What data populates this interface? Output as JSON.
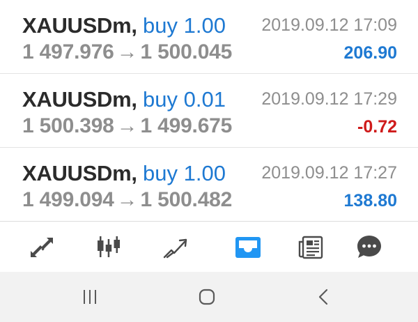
{
  "trades": [
    {
      "symbol": "XAUUSDm",
      "action": "buy 1.00",
      "time": "2019.09.12 17:09",
      "open_price": "1 497.976",
      "close_price": "1 500.045",
      "profit": "206.90",
      "profit_color": "#1e79d2"
    },
    {
      "symbol": "XAUUSDm",
      "action": "buy 0.01",
      "time": "2019.09.12 17:29",
      "open_price": "1 500.398",
      "close_price": "1 499.675",
      "profit": "-0.72",
      "profit_color": "#cf1b1b"
    },
    {
      "symbol": "XAUUSDm",
      "action": "buy 1.00",
      "time": "2019.09.12 17:27",
      "open_price": "1 499.094",
      "close_price": "1 500.482",
      "profit": "138.80",
      "profit_color": "#1e79d2"
    }
  ],
  "arrow": "→",
  "tabbar": {
    "tabs": [
      {
        "icon": "quotes-arrows-icon",
        "active": false
      },
      {
        "icon": "candlestick-chart-icon",
        "active": false
      },
      {
        "icon": "trade-trend-icon",
        "active": false
      },
      {
        "icon": "history-inbox-icon",
        "active": true
      },
      {
        "icon": "news-icon",
        "active": false
      },
      {
        "icon": "chat-icon",
        "active": false
      }
    ],
    "active_color": "#2196f3",
    "inactive_color": "#4a4a4a"
  },
  "navbar": {
    "buttons": [
      {
        "icon": "recent-apps-icon"
      },
      {
        "icon": "home-icon"
      },
      {
        "icon": "back-icon"
      }
    ]
  }
}
